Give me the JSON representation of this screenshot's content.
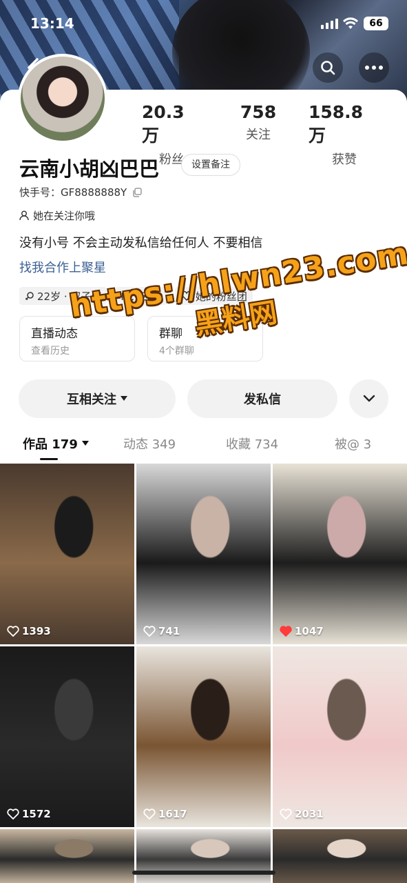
{
  "status_bar": {
    "time": "13:14",
    "battery": "66"
  },
  "profile": {
    "stats": [
      {
        "value": "20.3万",
        "label": "粉丝"
      },
      {
        "value": "758",
        "label": "关注"
      },
      {
        "value": "158.8万",
        "label": "获赞"
      }
    ],
    "name": "云南小胡凶巴巴",
    "remark_button": "设置备注",
    "kuaishou_id": "快手号：GF8888888Y",
    "follows_you": "她在关注你哦",
    "bio": "没有小号 不会主动发私信给任何人 不要相信",
    "link": "找我合作上聚星",
    "tags": [
      {
        "icon": "gender-female-icon",
        "text": "22岁 · 双子座"
      },
      {
        "icon": "",
        "text": "IP：云南"
      },
      {
        "icon": "fan-group-icon",
        "text": "她的粉丝团"
      }
    ],
    "mini_cards": [
      {
        "title": "直播动态",
        "subtitle": "查看历史"
      },
      {
        "title": "群聊",
        "subtitle": "4个群聊"
      }
    ]
  },
  "actions": {
    "follow": "互相关注",
    "message": "发私信"
  },
  "tabs": [
    {
      "label": "作品 179",
      "active": true
    },
    {
      "label": "动态 349",
      "active": false
    },
    {
      "label": "收藏 734",
      "active": false
    },
    {
      "label": "被@ 3",
      "active": false
    }
  ],
  "watermark": {
    "line1": "https://hlwn23.com",
    "line2": "黑料网"
  },
  "videos": [
    {
      "likes": "1393",
      "liked": false,
      "colors": [
        "#4a3a2e",
        "#8a6a4a",
        "#1b1b1b"
      ]
    },
    {
      "likes": "741",
      "liked": false,
      "colors": [
        "#d8d8d8",
        "#1a1a1a",
        "#c9b3a6"
      ]
    },
    {
      "likes": "1047",
      "liked": true,
      "colors": [
        "#e8e2d6",
        "#1d1d1d",
        "#caa"
      ]
    },
    {
      "likes": "1572",
      "liked": false,
      "colors": [
        "#1a1a1a",
        "#2a2a2a",
        "#3a3a3a"
      ]
    },
    {
      "likes": "1617",
      "liked": false,
      "colors": [
        "#e9e5de",
        "#7a5533",
        "#2a1f18"
      ]
    },
    {
      "likes": "2031",
      "liked": false,
      "colors": [
        "#efe7e2",
        "#f0c9c9",
        "#6a5a50"
      ]
    },
    {
      "likes": "",
      "liked": false,
      "colors": [
        "#c9b7a0",
        "#2a2a2a",
        "#8a7a66"
      ]
    },
    {
      "likes": "",
      "liked": false,
      "colors": [
        "#e6e1dc",
        "#3a3a3a",
        "#d8c7bb"
      ]
    },
    {
      "likes": "",
      "liked": false,
      "colors": [
        "#6b5a4a",
        "#2a2a2a",
        "#e4d5c8"
      ]
    }
  ]
}
